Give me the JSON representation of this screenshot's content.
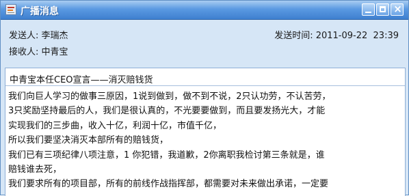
{
  "window": {
    "title": "广播消息",
    "controls": {
      "minimize": "minimize",
      "maximize": "maximize",
      "close": "×"
    }
  },
  "header": {
    "sender_label": "发送人:",
    "sender_name": "李瑞杰",
    "receiver_label": "接收人:",
    "receiver_name": "中青宝",
    "time_label": "发送时间:",
    "time_value": "2011-09-22  23:39"
  },
  "message": {
    "subject": "中青宝本任CEO宣言——消灭赔钱货",
    "lines": [
      "我们向巨人学习的做事三原因，1说到做到，做不到不说，2只认功劳，不认苦劳，",
      "3只奖励坚持最后的人，我们是很认真的，不光要要做到，而且要发扬光大，才能",
      "实现我们的三步曲，收入十亿，利润十亿，市值千亿，",
      "所以我们要坚决消灭本部所有的赔钱货，",
      "我们已有三项纪律八项注意，1 你犯错，我道歉，2你离职我检讨第三条就是，谁",
      "赔钱谁去死，",
      "我们要求所有的项目部，所有的前线作战指挥部，都需要对未来做出承诺，一定要"
    ]
  },
  "colors": {
    "titlebar": "#4f8fdc",
    "window_bg": "#d6e6f6",
    "border": "#8eaed6"
  },
  "icons": {
    "app": "message-app-icon",
    "minimize": "minimize-icon",
    "maximize": "maximize-icon",
    "close": "close-icon"
  }
}
